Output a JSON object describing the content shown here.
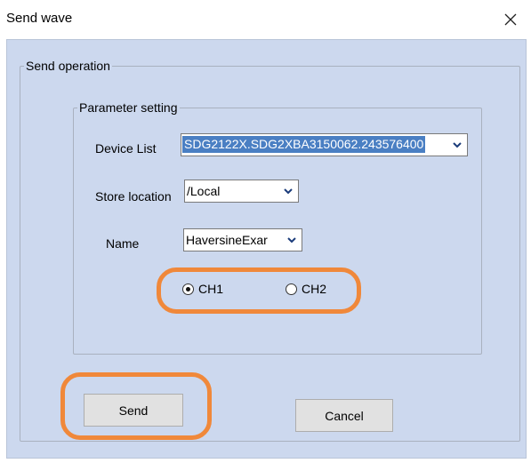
{
  "window": {
    "title": "Send wave",
    "close_glyph": "✕"
  },
  "outer_group": {
    "label": "Send operation"
  },
  "param_group": {
    "label": "Parameter  setting"
  },
  "device_list": {
    "label": "Device List",
    "value": "SDG2122X.SDG2XBA3150062.243576400"
  },
  "store_location": {
    "label": "Store location",
    "value": "/Local"
  },
  "name": {
    "label": "Name",
    "value": "HaversineExar"
  },
  "channels": {
    "ch1": {
      "label": "CH1",
      "checked": true
    },
    "ch2": {
      "label": "CH2",
      "checked": false
    }
  },
  "buttons": {
    "send": "Send",
    "cancel": "Cancel"
  },
  "colors": {
    "highlight": "#f0883a",
    "dialog_bg": "#ccd8ee",
    "selection": "#4a7fc3"
  },
  "icons": {
    "close": "close-icon",
    "dropdown": "chevron-down-icon"
  }
}
